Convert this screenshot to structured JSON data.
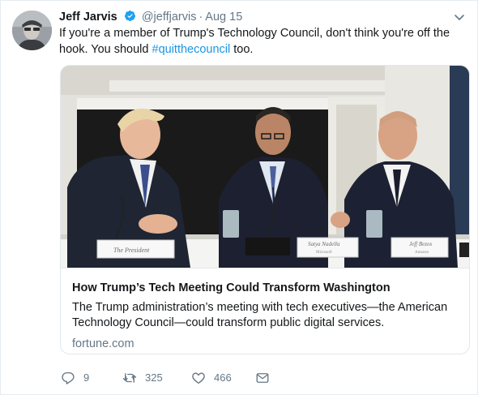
{
  "tweet": {
    "author_name": "Jeff Jarvis",
    "handle": "@jeffjarvis",
    "separator": "·",
    "date": "Aug 15",
    "text_before": "If you're a member of Trump's Technology Council, don't think you're off the hook. You should ",
    "hashtag": "#quitthecouncil",
    "text_after": " too.",
    "verified": true
  },
  "card": {
    "title": "How Trump’s Tech Meeting Could Transform Washington",
    "description": "The Trump administration’s meeting with tech executives—the American Technology Council—could transform public digital services.",
    "domain": "fortune.com",
    "image_placards": [
      "The President",
      "Satya Nadella",
      "Jeff Bezos"
    ],
    "image_placard_subtitles": [
      "Microsoft",
      "Amazon"
    ]
  },
  "actions": {
    "reply_count": "9",
    "retweet_count": "325",
    "like_count": "466"
  },
  "icons": {
    "reply": "reply-icon",
    "retweet": "retweet-icon",
    "like": "heart-icon",
    "dm": "envelope-icon",
    "verified": "verified-badge-icon",
    "caret": "chevron-down-icon"
  },
  "colors": {
    "link": "#1b95e0",
    "secondary_text": "#657786",
    "verified": "#1da1f2"
  }
}
